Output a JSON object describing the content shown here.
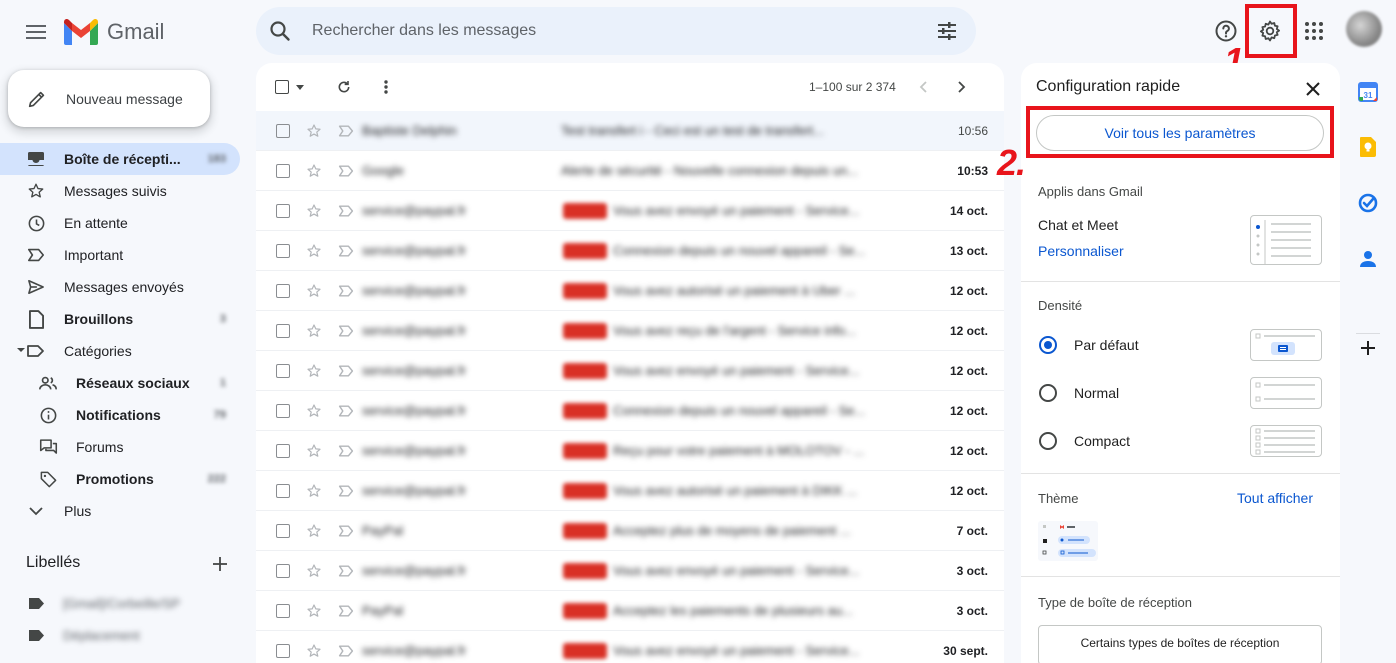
{
  "header": {
    "app_name": "Gmail",
    "search_placeholder": "Rechercher dans les messages"
  },
  "annotations": {
    "step1": "1.",
    "step2": "2."
  },
  "compose": {
    "label": "Nouveau message"
  },
  "nav": {
    "items": [
      {
        "label": "Boîte de récepti...",
        "count": "183",
        "icon": "inbox-icon"
      },
      {
        "label": "Messages suivis",
        "icon": "star-icon"
      },
      {
        "label": "En attente",
        "icon": "clock-icon"
      },
      {
        "label": "Important",
        "icon": "important-icon"
      },
      {
        "label": "Messages envoyés",
        "icon": "send-icon"
      },
      {
        "label": "Brouillons",
        "count": "3",
        "icon": "draft-icon"
      },
      {
        "label": "Catégories",
        "icon": "label-icon"
      },
      {
        "label": "Réseaux sociaux",
        "count": "1",
        "icon": "people-icon"
      },
      {
        "label": "Notifications",
        "count": "79",
        "icon": "info-icon"
      },
      {
        "label": "Forums",
        "icon": "forum-icon"
      },
      {
        "label": "Promotions",
        "count": "222",
        "icon": "tag-icon"
      },
      {
        "label": "Plus",
        "icon": "chevron-down-icon"
      }
    ],
    "labels_title": "Libellés",
    "labels": [
      "[Gmail]/Corbeille/SP",
      "Déplacement"
    ]
  },
  "list": {
    "pagination": "1–100 sur 2 374",
    "rows": [
      {
        "sender": "Baptiste Delphin",
        "subject": "Test transfert i - Ceci est un test de transfert...",
        "date": "10:56",
        "read": true,
        "tagged": false
      },
      {
        "sender": "Google",
        "subject": "Alerte de sécurité - Nouvelle connexion depuis un...",
        "date": "10:53",
        "read": false,
        "tagged": false
      },
      {
        "sender": "service@paypal.fr",
        "subject": "Vous avez envoyé un paiement - Service...",
        "date": "14 oct.",
        "read": false,
        "tagged": true
      },
      {
        "sender": "service@paypal.fr",
        "subject": "Connexion depuis un nouvel appareil - Se...",
        "date": "13 oct.",
        "read": false,
        "tagged": true
      },
      {
        "sender": "service@paypal.fr",
        "subject": "Vous avez autorisé un paiement à Uber ...",
        "date": "12 oct.",
        "read": false,
        "tagged": true
      },
      {
        "sender": "service@paypal.fr",
        "subject": "Vous avez reçu de l'argent - Service info...",
        "date": "12 oct.",
        "read": false,
        "tagged": true
      },
      {
        "sender": "service@paypal.fr",
        "subject": "Vous avez envoyé un paiement - Service...",
        "date": "12 oct.",
        "read": false,
        "tagged": true
      },
      {
        "sender": "service@paypal.fr",
        "subject": "Connexion depuis un nouvel appareil - Se...",
        "date": "12 oct.",
        "read": false,
        "tagged": true
      },
      {
        "sender": "service@paypal.fr",
        "subject": "Reçu pour votre paiement à MOLOTOV - ...",
        "date": "12 oct.",
        "read": false,
        "tagged": true
      },
      {
        "sender": "service@paypal.fr",
        "subject": "Vous avez autorisé un paiement à DIKK ...",
        "date": "12 oct.",
        "read": false,
        "tagged": true
      },
      {
        "sender": "PayPal",
        "subject": "Acceptez plus de moyens de paiement ...",
        "date": "7 oct.",
        "read": false,
        "tagged": true
      },
      {
        "sender": "service@paypal.fr",
        "subject": "Vous avez envoyé un paiement - Service...",
        "date": "3 oct.",
        "read": false,
        "tagged": true
      },
      {
        "sender": "PayPal",
        "subject": "Acceptez les paiements de plusieurs au...",
        "date": "3 oct.",
        "read": false,
        "tagged": true
      },
      {
        "sender": "service@paypal.fr",
        "subject": "Vous avez envoyé un paiement - Service...",
        "date": "30 sept.",
        "read": false,
        "tagged": true
      }
    ]
  },
  "quick_settings": {
    "title": "Configuration rapide",
    "see_all": "Voir tous les paramètres",
    "apps_title": "Applis dans Gmail",
    "chat_meet": "Chat et Meet",
    "customize": "Personnaliser",
    "density_title": "Densité",
    "density_options": [
      "Par défaut",
      "Normal",
      "Compact"
    ],
    "density_selected": "Par défaut",
    "theme_title": "Thème",
    "theme_link": "Tout afficher",
    "inbox_type_title": "Type de boîte de réception",
    "inbox_type_value": "Certains types de boîtes de réception"
  },
  "colors": {
    "accent": "#0b57d0",
    "annotation_red": "#e8141b",
    "nav_active": "#d3e3fd"
  }
}
